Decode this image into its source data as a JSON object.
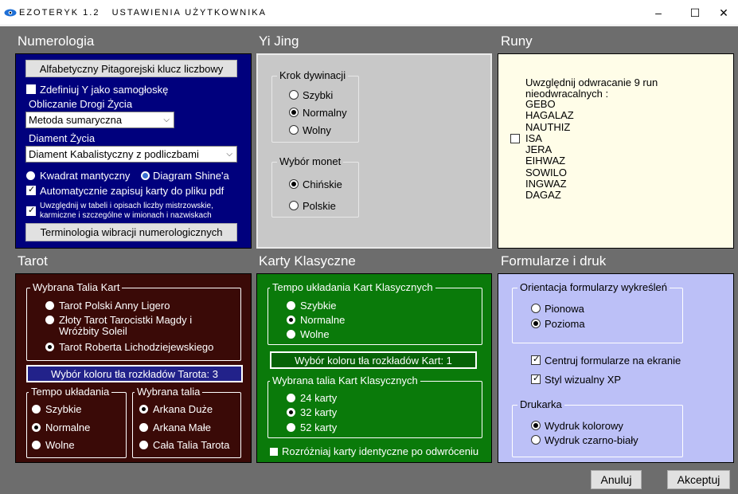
{
  "window": {
    "app_name": "EZOTERYK 1.2",
    "title": "USTAWIENIA UŻYTKOWNIKA",
    "minimize": "–",
    "maximize": "☐",
    "close": "✕"
  },
  "numerologia": {
    "title": "Numerologia",
    "key_button": "Alfabetyczny Pitagorejski klucz liczbowy",
    "y_vowel": "Zdefiniuj Y jako samogłoskę",
    "life_path_label": "Obliczanie Drogi Życia",
    "life_path_value": "Metoda sumaryczna",
    "diamond_label": "Diament Życia",
    "diamond_value": "Diament Kabalistyczny z podliczbami",
    "square_mantic": "Kwadrat mantyczny",
    "shine_diagram": "Diagram Shine'a",
    "autosave_pdf": "Automatycznie zapisuj karty do pliku pdf",
    "master_numbers_line1": "Uwzględnij  w tabeli i opisach liczby mistrzowskie,",
    "master_numbers_line2": "karmiczne i szczególne w imionach i nazwiskach",
    "vibration_button": "Terminologia wibracji numerologicznych"
  },
  "yijing": {
    "title": "Yi Jing",
    "step_label": "Krok dywinacji",
    "step_options": [
      "Szybki",
      "Normalny",
      "Wolny"
    ],
    "coins_label": "Wybór monet",
    "coins_options": [
      "Chińskie",
      "Polskie"
    ]
  },
  "runy": {
    "title": "Runy",
    "reverse_line1": "Uwzględnij odwracanie 9 run",
    "reverse_line2": "nieodwracalnych :",
    "runes": [
      "GEBO",
      "HAGALAZ",
      "NAUTHIZ",
      "ISA",
      "JERA",
      "EIHWAZ",
      "SOWILO",
      "INGWAZ",
      "DAGAZ"
    ]
  },
  "tarot": {
    "title": "Tarot",
    "deck_label": "Wybrana Talia Kart",
    "decks": [
      "Tarot Polski Anny Ligero",
      "Złoty Tarot Tarocistki Magdy i",
      "Wróżbity Soleil",
      "Tarot Roberta Lichodziejewskiego"
    ],
    "color_button": "Wybór koloru tła rozkładów Tarota: 3",
    "tempo_label": "Tempo układania",
    "tempo_options": [
      "Szybkie",
      "Normalne",
      "Wolne"
    ],
    "talia_label": "Wybrana talia",
    "talia_options": [
      "Arkana Duże",
      "Arkana Małe",
      "Cała Talia Tarota"
    ]
  },
  "karty": {
    "title": "Karty Klasyczne",
    "tempo_label": "Tempo układania Kart Klasycznych",
    "tempo_options": [
      "Szybkie",
      "Normalne",
      "Wolne"
    ],
    "color_button": "Wybór koloru tła rozkładów Kart: 1",
    "deck_label": "Wybrana talia Kart Klasycznych",
    "deck_options": [
      "24 karty",
      "32 karty",
      "52 karty"
    ],
    "distinguish": "Rozróżniaj karty identyczne po odwróceniu"
  },
  "formularze": {
    "title": "Formularze i druk",
    "orientation_label": "Orientacja formularzy wykreśleń",
    "orientation_options": [
      "Pionowa",
      "Pozioma"
    ],
    "center_forms": "Centruj formularze na ekranie",
    "xp_style": "Styl wizualny XP",
    "printer_label": "Drukarka",
    "printer_options": [
      "Wydruk kolorowy",
      "Wydruk czarno-biały"
    ]
  },
  "buttons": {
    "cancel": "Anuluj",
    "accept": "Akceptuj"
  },
  "colors": {
    "client_bg": "#6d6d6d",
    "numerologia_bg": "#00007d",
    "yijing_bg": "#c8c8c8",
    "runy_bg": "#fffde8",
    "tarot_bg": "#3a0a07",
    "karty_bg": "#0a7a0a",
    "formularze_bg": "#bcc0f7"
  }
}
